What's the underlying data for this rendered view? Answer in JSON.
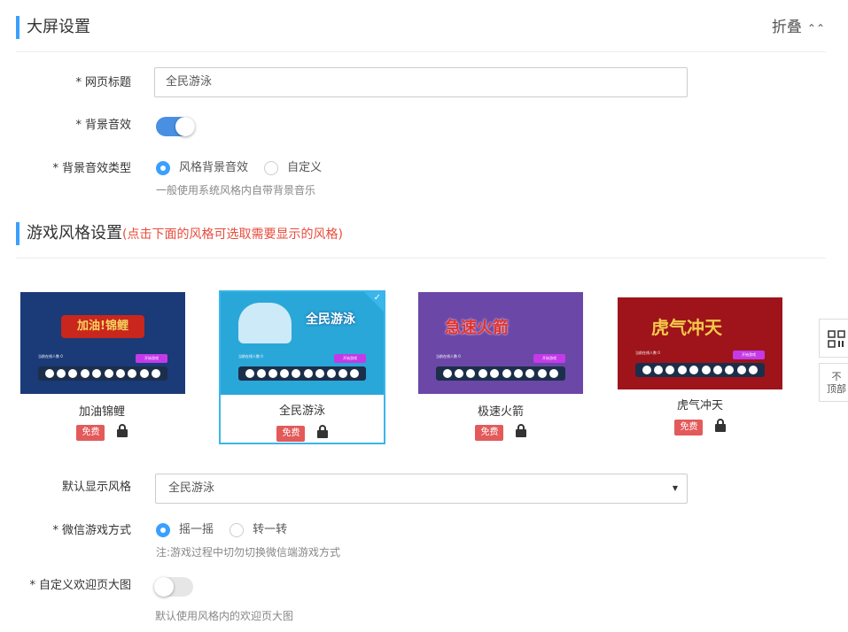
{
  "screen_section": {
    "title": "大屏设置",
    "fold_label": "折叠",
    "fold_icon": "chevron-up-double"
  },
  "fields": {
    "page_title": {
      "label": "网页标题",
      "value": "全民游泳"
    },
    "bg_sound": {
      "label": "背景音效",
      "enabled": true
    },
    "bg_sound_type": {
      "label": "背景音效类型",
      "options": [
        "风格背景音效",
        "自定义"
      ],
      "selected": "风格背景音效",
      "hint": "一般使用系统风格内自带背景音乐"
    }
  },
  "style_section": {
    "title": "游戏风格设置",
    "note": "(点击下面的风格可选取需要显示的风格)"
  },
  "styles": [
    {
      "name": "加油锦鲤",
      "thumb_title": "加油!锦鲤",
      "badge": "免费",
      "selected": false,
      "bg": "#1a3a78",
      "accent": "#e7a21c"
    },
    {
      "name": "全民游泳",
      "thumb_title": "全民游泳",
      "badge": "免费",
      "selected": true,
      "bg": "#2aa7d9",
      "accent": "#ffffff"
    },
    {
      "name": "极速火箭",
      "thumb_title": "急速火箭",
      "badge": "免费",
      "selected": false,
      "bg": "#6b47a8",
      "accent": "#e2312f"
    },
    {
      "name": "虎气冲天",
      "thumb_title": "虎气冲天",
      "badge": "免费",
      "selected": false,
      "bg": "#9e141a",
      "accent": "#f5c84a"
    }
  ],
  "thumb_text": {
    "online": "当前在线人数 0",
    "start": "开始游戏"
  },
  "default_style": {
    "label": "默认显示风格",
    "value": "全民游泳"
  },
  "wechat_mode": {
    "label": "微信游戏方式",
    "options": [
      "摇一摇",
      "转一转"
    ],
    "selected": "摇一摇",
    "hint": "注:游戏过程中切勿切换微信端游戏方式"
  },
  "welcome_image": {
    "label": "自定义欢迎页大图",
    "enabled": false,
    "hint": "默认使用风格内的欢迎页大图"
  },
  "float": {
    "qr_icon": "qrcode-icon",
    "top_label_1": "不",
    "top_label_2": "顶部"
  },
  "required_mark": "*"
}
